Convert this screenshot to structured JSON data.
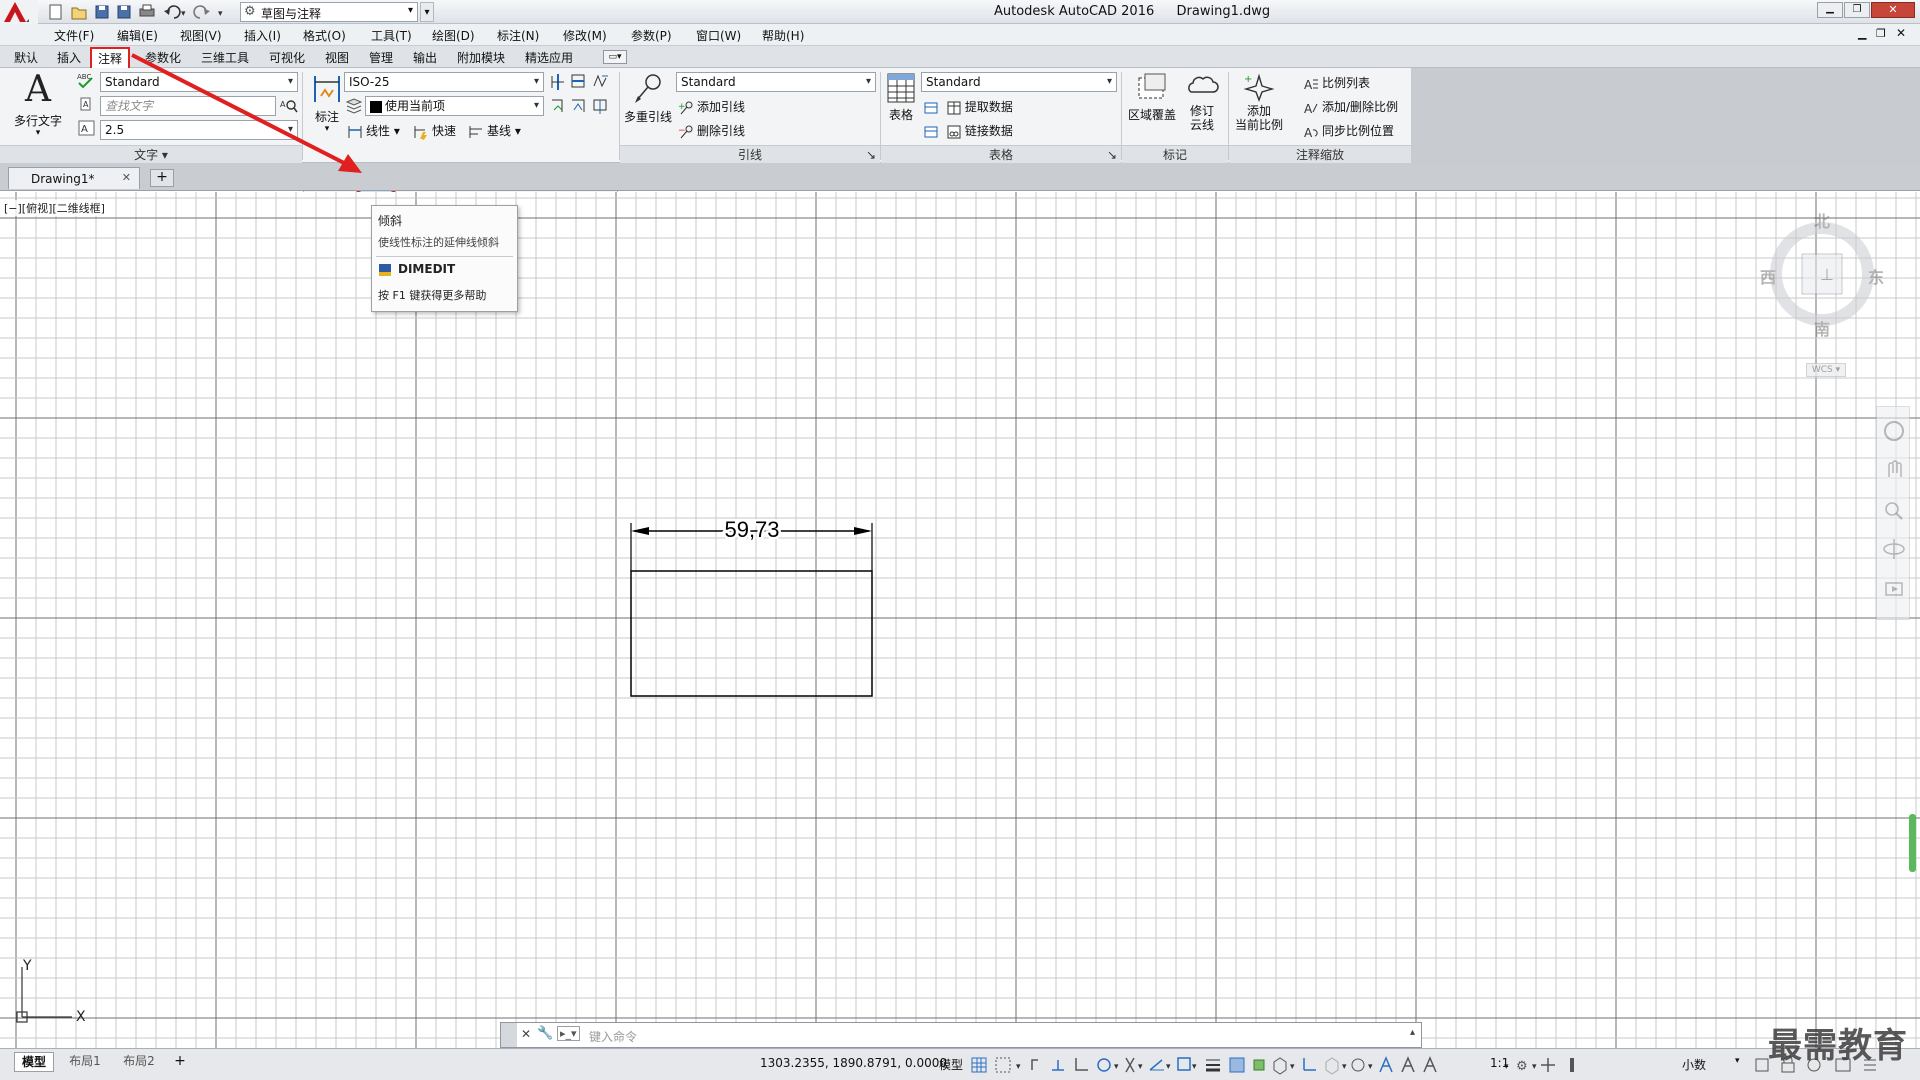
{
  "app": {
    "title": "Autodesk AutoCAD 2016",
    "document": "Drawing1.dwg",
    "workspace": "草图与注释",
    "accent": "#c8161d"
  },
  "menus": [
    "文件(F)",
    "编辑(E)",
    "视图(V)",
    "插入(I)",
    "格式(O)",
    "工具(T)",
    "绘图(D)",
    "标注(N)",
    "修改(M)",
    "参数(P)",
    "窗口(W)",
    "帮助(H)"
  ],
  "ribbon_tabs": [
    "默认",
    "插入",
    "注释",
    "参数化",
    "三维工具",
    "可视化",
    "视图",
    "管理",
    "输出",
    "附加模块",
    "精选应用"
  ],
  "active_tab": "注释",
  "ribbon": {
    "text_group": {
      "label": "文字",
      "mtext": "多行文字",
      "style": "Standard",
      "find_placeholder": "查找文字",
      "height": "2.5"
    },
    "dim_group": {
      "label": "标注",
      "dim_button": "标注",
      "style": "ISO-25",
      "layer": "使用当前项",
      "linear": "线性",
      "quick": "快速",
      "baseline": "基线"
    },
    "leader_group": {
      "label": "引线",
      "mleader": "多重引线",
      "style": "Standard",
      "add": "添加引线",
      "remove": "删除引线"
    },
    "table_group": {
      "label": "表格",
      "table": "表格",
      "style": "Standard",
      "extract": "提取数据",
      "link": "链接数据"
    },
    "markup_group": {
      "label": "标记",
      "wipeout": "区域覆盖",
      "revcloud_1": "修订",
      "revcloud_2": "云线"
    },
    "scale_group": {
      "label": "注释缩放",
      "add_1": "添加",
      "add_2": "当前比例",
      "scale_list": "比例列表",
      "add_delete": "添加/删除比例",
      "sync": "同步比例位置"
    }
  },
  "doc_tab": "Drawing1*",
  "viewport_label": "[−][俯视][二维线框]",
  "tooltip": {
    "title": "倾斜",
    "desc": "使线性标注的延伸线倾斜",
    "command": "DIMEDIT",
    "help": "按 F1 键获得更多帮助"
  },
  "viewcube": {
    "north": "北",
    "south": "南",
    "east": "东",
    "west": "西",
    "wcs": "WCS"
  },
  "drawing": {
    "dimension_text": "59,73"
  },
  "ucs": {
    "y": "Y",
    "x": "X"
  },
  "command_placeholder": "键入命令",
  "layout_tabs": [
    "模型",
    "布局1",
    "布局2"
  ],
  "status": {
    "coords": "1303.2355, 1890.8791, 0.0000",
    "mode": "模型",
    "scale": "1:1",
    "units": "小数"
  },
  "watermark": "最需教育"
}
